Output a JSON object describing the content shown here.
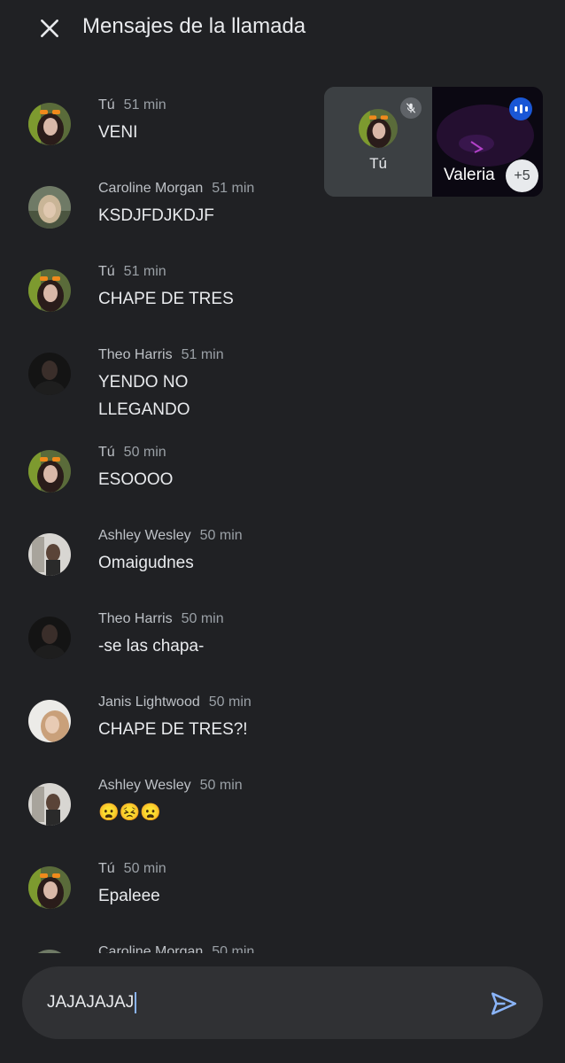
{
  "header": {
    "title": "Mensajes de la llamada",
    "close_icon": "close-icon"
  },
  "pip": {
    "self_name": "Tú",
    "other_name": "Valeria",
    "more_count": "+5",
    "mic_icon": "mic-off-icon",
    "speaking_icon": "speaking-indicator-icon"
  },
  "messages": [
    {
      "sender": "Tú",
      "time": "51 min",
      "text": "VENI",
      "avatar": "self"
    },
    {
      "sender": "Caroline Morgan",
      "time": "51 min",
      "text": "KSDJFDJKDJF",
      "avatar": "caroline"
    },
    {
      "sender": "Tú",
      "time": "51 min",
      "text": "CHAPE DE TRES",
      "avatar": "self"
    },
    {
      "sender": "Theo Harris",
      "time": "51 min",
      "text": "YENDO NO\nLLEGANDO",
      "avatar": "theo"
    },
    {
      "sender": "Tú",
      "time": "50 min",
      "text": "ESOOOO",
      "avatar": "self"
    },
    {
      "sender": "Ashley Wesley",
      "time": "50 min",
      "text": "Omaigudnes",
      "avatar": "ashley"
    },
    {
      "sender": "Theo Harris",
      "time": "50 min",
      "text": "-se las chapa-",
      "avatar": "theo"
    },
    {
      "sender": "Janis Lightwood",
      "time": "50 min",
      "text": "CHAPE DE TRES?!",
      "avatar": "janis"
    },
    {
      "sender": "Ashley Wesley",
      "time": "50 min",
      "text": "😦😣😦",
      "avatar": "ashley"
    },
    {
      "sender": "Tú",
      "time": "50 min",
      "text": "Epaleee",
      "avatar": "self"
    },
    {
      "sender": "Caroline Morgan",
      "time": "50 min",
      "text": "",
      "avatar": "caroline"
    }
  ],
  "composer": {
    "value": "JAJAJAJAJ",
    "send_icon": "send-icon"
  }
}
